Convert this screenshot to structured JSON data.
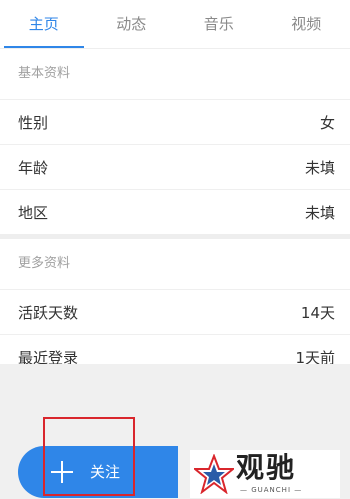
{
  "tabs": [
    {
      "label": "主页",
      "active": true
    },
    {
      "label": "动态",
      "active": false
    },
    {
      "label": "音乐",
      "active": false
    },
    {
      "label": "视频",
      "active": false
    }
  ],
  "basic": {
    "header": "基本资料",
    "rows": [
      {
        "label": "性别",
        "value": "女"
      },
      {
        "label": "年龄",
        "value": "未填"
      },
      {
        "label": "地区",
        "value": "未填"
      }
    ]
  },
  "more": {
    "header": "更多资料",
    "rows": [
      {
        "label": "活跃天数",
        "value": "14天"
      },
      {
        "label": "最近登录",
        "value": "1天前"
      }
    ]
  },
  "follow": {
    "label": "关注",
    "icon": "plus-icon"
  },
  "watermark": {
    "title": "观驰",
    "subtitle": "— GUANCHI —"
  },
  "colors": {
    "accent": "#2f86e8",
    "highlight": "#d9262c"
  }
}
